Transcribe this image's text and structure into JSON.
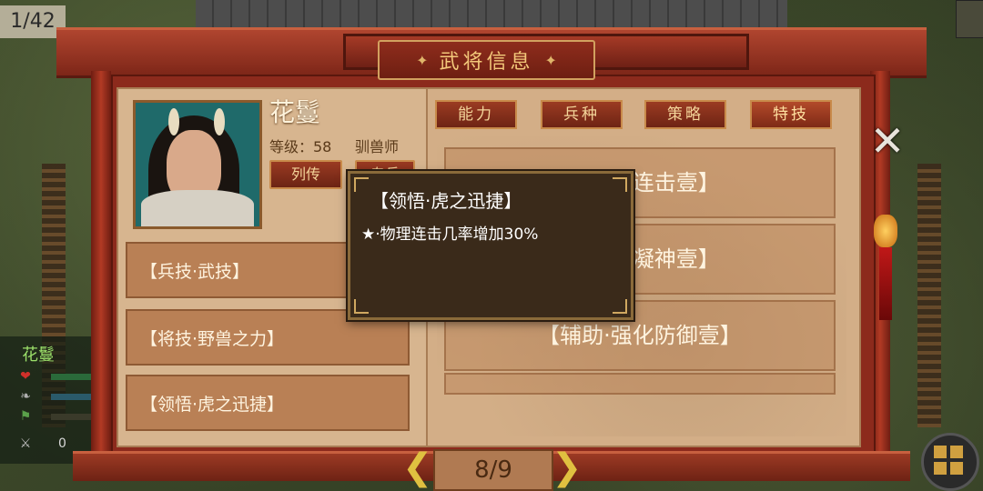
{
  "hud": {
    "counter": "1/42"
  },
  "window": {
    "title": "武将信息",
    "title_ornament_left": "✦",
    "title_ornament_right": "✦"
  },
  "hero": {
    "name": "花鬘",
    "level": "等级：58",
    "class": "驯兽师",
    "bio_button": "列传",
    "second_button": "专兵"
  },
  "tabs": [
    {
      "label": "能力",
      "active": false
    },
    {
      "label": "兵种",
      "active": false
    },
    {
      "label": "策略",
      "active": false
    },
    {
      "label": "特技",
      "active": true
    }
  ],
  "left_skills": [
    "【兵技·武技】",
    "【将技·野兽之力】",
    "【领悟·虎之迅捷】"
  ],
  "right_skills": [
    "【暴击·连击壹】",
    "【辅助·凝神壹】",
    "【辅助·强化防御壹】"
  ],
  "tooltip": {
    "title": "【领悟·虎之迅捷】",
    "description": "★·物理连击几率增加30%"
  },
  "pagination": {
    "current": "8/9",
    "prev_icon": "chevron-left-icon",
    "next_icon": "chevron-right-icon"
  },
  "side_status": {
    "name": "花鬘",
    "icons": [
      "heart-icon",
      "feather-icon",
      "flag-icon"
    ],
    "sword_count": "0"
  },
  "colors": {
    "frame_red": "#8c2a1c",
    "parchment": "#d7b58f",
    "gold": "#f4d59a",
    "tooltip_bg": "#3a2a1a"
  }
}
